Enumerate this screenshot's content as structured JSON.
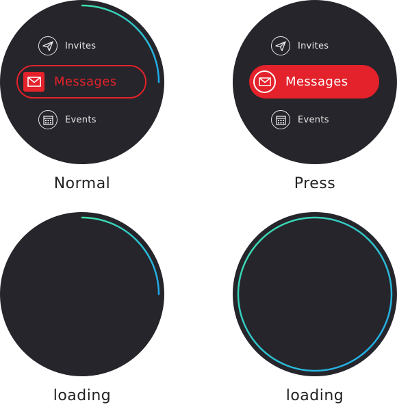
{
  "colors": {
    "face": "#26252b",
    "accent": "#e3222b",
    "arc_start": "#3fe0a8",
    "arc_end": "#1ea8ef",
    "text_light": "#e8e8e8"
  },
  "menu": {
    "invites": {
      "label": "Invites",
      "icon": "paper-plane-icon"
    },
    "messages": {
      "label": "Messages",
      "icon": "envelope-icon"
    },
    "events": {
      "label": "Events",
      "icon": "calendar-icon"
    }
  },
  "states": {
    "normal": {
      "caption": "Normal",
      "progress": 0.25
    },
    "press": {
      "caption": "Press"
    },
    "loading_partial": {
      "caption": "loading",
      "progress": 0.25
    },
    "loading_full": {
      "caption": "loading",
      "progress": 1.0
    }
  }
}
